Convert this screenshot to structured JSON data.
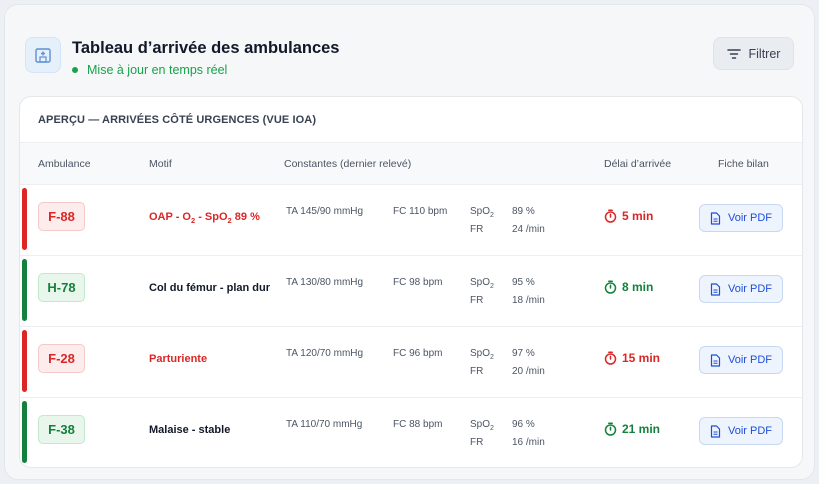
{
  "header": {
    "title": "Tableau d’arrivée des ambulances",
    "status": "Mise à jour en temps réel",
    "filter_label": "Filtrer",
    "icon": "hospital-icon"
  },
  "table": {
    "title": "APERÇU — ARRIVÉES CÔTÉ URGENCES (VUE IOA)",
    "columns": {
      "ambulance": "Ambulance",
      "motif": "Motif",
      "constantes": "Constantes (dernier relevé)",
      "delai": "Délai d’arrivée",
      "fiche": "Fiche bilan"
    },
    "rows": [
      {
        "id": "F-88",
        "severity": "red",
        "motif_html": "OAP - O<sub>2</sub> - SpO<sub>2</sub> 89 %",
        "ta": "TA 145/90 mmHg",
        "fc": "FC 110 bpm",
        "spo2_label": "SpO<sub>2</sub>",
        "spo2_value": "89 %",
        "fr_label": "FR",
        "fr_value": "24 /min",
        "delay": "5 min",
        "pdf_label": "Voir PDF"
      },
      {
        "id": "H-78",
        "severity": "green",
        "motif_html": "Col du fémur - plan dur",
        "ta": "TA 130/80 mmHg",
        "fc": "FC 98 bpm",
        "spo2_label": "SpO<sub>2</sub>",
        "spo2_value": "95 %",
        "fr_label": "FR",
        "fr_value": "18 /min",
        "delay": "8 min",
        "pdf_label": "Voir PDF"
      },
      {
        "id": "F-28",
        "severity": "red",
        "motif_html": "Parturiente",
        "ta": "TA 120/70 mmHg",
        "fc": "FC 96 bpm",
        "spo2_label": "SpO<sub>2</sub>",
        "spo2_value": "97 %",
        "fr_label": "FR",
        "fr_value": "20 /min",
        "delay": "15 min",
        "pdf_label": "Voir PDF"
      },
      {
        "id": "F-38",
        "severity": "green",
        "motif_html": "Malaise - stable",
        "ta": "TA 110/70 mmHg",
        "fc": "FC 88 bpm",
        "spo2_label": "SpO<sub>2</sub>",
        "spo2_value": "96 %",
        "fr_label": "FR",
        "fr_value": "16 /min",
        "delay": "21 min",
        "pdf_label": "Voir PDF"
      }
    ]
  },
  "colors": {
    "red": "#dc2626",
    "green": "#15803d",
    "accent_blue": "#1d4ed8"
  }
}
